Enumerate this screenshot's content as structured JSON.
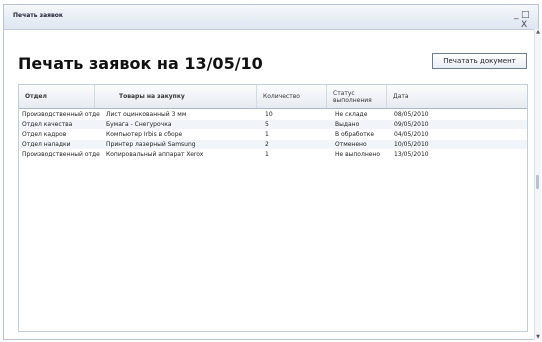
{
  "window": {
    "title": "Печать заявок",
    "minimize_label": "_",
    "close_label": "□ X"
  },
  "page": {
    "heading": "Печать заявок на 13/05/10",
    "print_button": "Печатать документ"
  },
  "table": {
    "columns": [
      "Отдел",
      "Товары на закупку",
      "Количество",
      "Статус выполнения",
      "Дата"
    ],
    "rows": [
      [
        "Производственный отдел",
        "Лист оцинкованный 3 мм",
        "10",
        "Не складе",
        "08/05/2010"
      ],
      [
        "Отдел качества",
        "Бумага - Снегурочка",
        "5",
        "Выдано",
        "09/05/2010"
      ],
      [
        "Отдел кадров",
        "Компьютер Irbis в сборе",
        "1",
        "В обработке",
        "04/05/2010"
      ],
      [
        "Отдел наладки",
        "Принтер лазерный Samsung",
        "2",
        "Отменено",
        "10/05/2010"
      ],
      [
        "Производственный отдел",
        "Копировальный аппарат Xerox",
        "1",
        "Не выполнено",
        "13/05/2010"
      ]
    ]
  }
}
